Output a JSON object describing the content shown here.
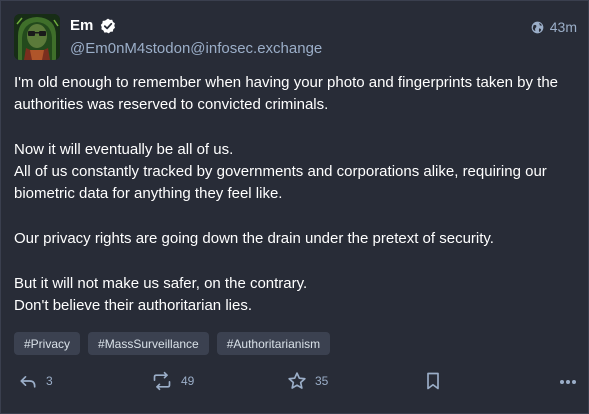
{
  "author": {
    "display_name": "Em",
    "handle": "@Em0nM4stodon@infosec.exchange",
    "verified_icon": "check-circle-icon",
    "avatar_icon": "avatar-image"
  },
  "meta": {
    "visibility_icon": "globe-icon",
    "timestamp": "43m"
  },
  "content": {
    "paragraphs": [
      [
        "I'm old enough to remember when having your photo and fingerprints taken by the authorities was reserved to convicted criminals."
      ],
      [
        "Now it will eventually be all of us.",
        "All of us constantly tracked by governments and corporations alike, requiring our biometric data for anything they feel like."
      ],
      [
        "Our privacy rights are going down the drain under the pretext of security."
      ],
      [
        "But it will not make us safer, on the contrary.",
        "Don't believe their authoritarian lies."
      ]
    ]
  },
  "hashtags": [
    "#Privacy",
    "#MassSurveillance",
    "#Authoritarianism"
  ],
  "actions": {
    "reply": {
      "icon": "reply-icon",
      "count": "3"
    },
    "boost": {
      "icon": "boost-icon",
      "count": "49"
    },
    "favourite": {
      "icon": "star-icon",
      "count": "35"
    },
    "bookmark": {
      "icon": "bookmark-icon"
    },
    "more": {
      "icon": "more-horizontal-icon"
    }
  },
  "colors": {
    "background": "#282c37",
    "text": "#ffffff",
    "secondary_text": "#9baec8",
    "hashtag_bg": "#3b4150",
    "hashtag_text": "#d9e1e8"
  }
}
